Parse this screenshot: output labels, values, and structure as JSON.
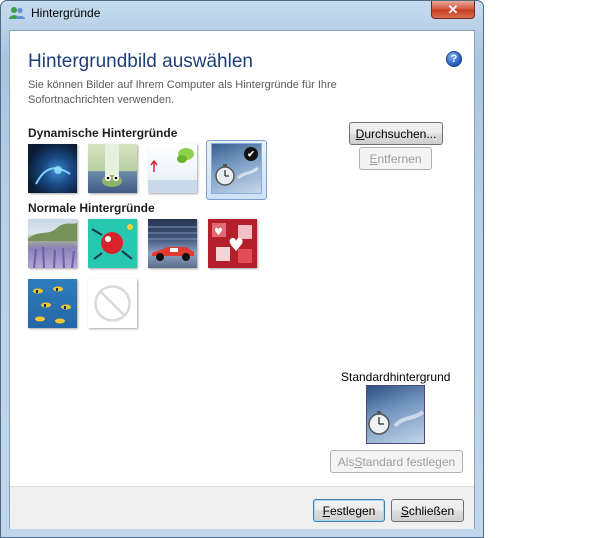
{
  "window": {
    "title": "Hintergründe",
    "close_label": "✕"
  },
  "header": {
    "heading": "Hintergrundbild auswählen",
    "help_label": "?",
    "description": "Sie können Bilder auf Ihrem Computer als Hintergründe für Ihre Sofortnachrichten verwenden."
  },
  "dynamic": {
    "label": "Dynamische Hintergründe",
    "items": [
      {
        "name": "dynamic-bg-blue-creatures"
      },
      {
        "name": "dynamic-bg-cartoon-character"
      },
      {
        "name": "dynamic-bg-green-butterfly"
      },
      {
        "name": "dynamic-bg-stopwatch",
        "selected": true
      }
    ]
  },
  "normal": {
    "label": "Normale Hintergründe",
    "items": [
      {
        "name": "normal-bg-lavender"
      },
      {
        "name": "normal-bg-frog-turquoise"
      },
      {
        "name": "normal-bg-race-car"
      },
      {
        "name": "normal-bg-red-hearts"
      },
      {
        "name": "normal-bg-fish"
      },
      {
        "name": "normal-bg-none"
      }
    ]
  },
  "buttons": {
    "browse_prefix": "D",
    "browse_rest": "urchsuchen...",
    "remove_prefix": "E",
    "remove_rest": "ntfernen",
    "set_default_pre": "Als ",
    "set_default_u": "S",
    "set_default_post": "tandard festlegen",
    "apply_prefix": "F",
    "apply_rest": "estlegen",
    "close_prefix": "S",
    "close_rest": "chließen"
  },
  "standard": {
    "label": "Standardhintergrund"
  },
  "colors": {
    "heading": "#1e3f7a",
    "accent_border": "#3c7fb1"
  }
}
